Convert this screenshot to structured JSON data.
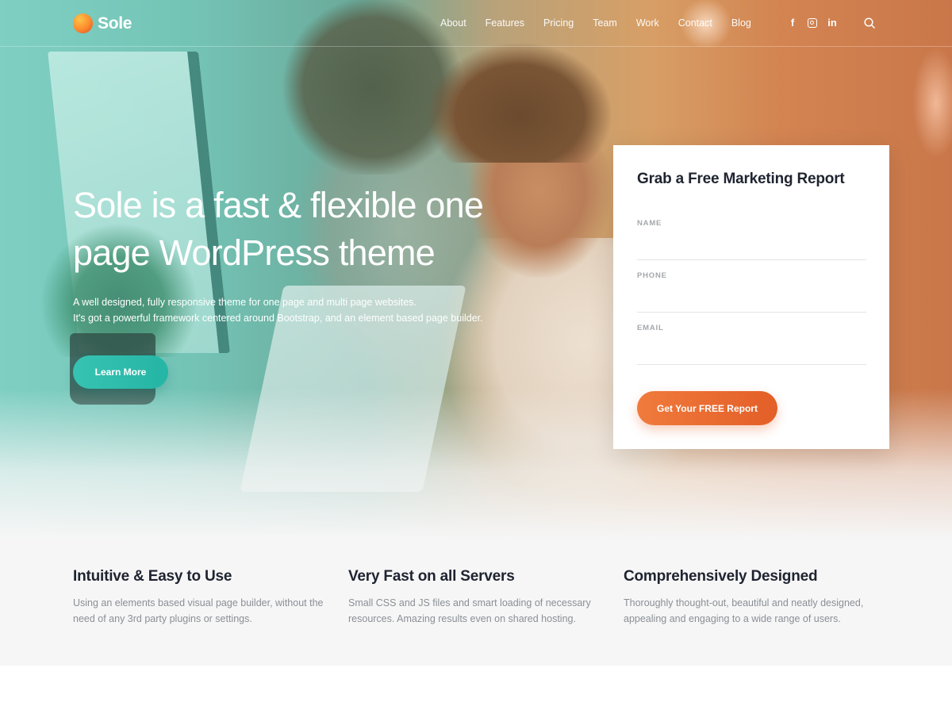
{
  "brand": {
    "name": "Sole",
    "accent_teal": "#2bbbaa",
    "accent_orange": "#e8672e"
  },
  "nav": {
    "items": [
      {
        "label": "About"
      },
      {
        "label": "Features"
      },
      {
        "label": "Pricing"
      },
      {
        "label": "Team"
      },
      {
        "label": "Work"
      },
      {
        "label": "Contact"
      },
      {
        "label": "Blog"
      }
    ],
    "social": [
      {
        "icon": "facebook-icon",
        "glyph": "f"
      },
      {
        "icon": "instagram-icon",
        "glyph": ""
      },
      {
        "icon": "linkedin-icon",
        "glyph": "in"
      }
    ],
    "search_icon": "search-icon"
  },
  "hero": {
    "title": "Sole is a fast & flexible one page WordPress theme",
    "subtitle_line1": "A well designed, fully responsive theme for one page and multi page websites.",
    "subtitle_line2": "It's got a powerful framework centered around Bootstrap, and an element based page builder.",
    "cta_label": "Learn More"
  },
  "form": {
    "title": "Grab a Free Marketing Report",
    "fields": [
      {
        "label": "NAME",
        "value": ""
      },
      {
        "label": "PHONE",
        "value": ""
      },
      {
        "label": "EMAIL",
        "value": ""
      }
    ],
    "submit_label": "Get Your FREE Report"
  },
  "features": [
    {
      "title": "Intuitive & Easy to Use",
      "text": "Using an elements based visual page builder, without the need of any 3rd party plugins or settings."
    },
    {
      "title": "Very Fast on all Servers",
      "text": "Small CSS and JS files and smart loading of necessary resources. Amazing results even on shared hosting."
    },
    {
      "title": "Comprehensively Designed",
      "text": "Thoroughly thought-out, beautiful and neatly designed, appealing and engaging to a wide range of users."
    }
  ]
}
